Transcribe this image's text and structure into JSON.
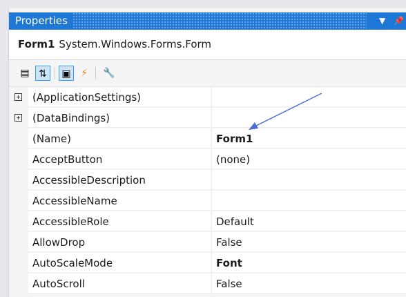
{
  "window": {
    "title": "Properties",
    "dropdown_glyph": "▼",
    "pin_glyph": "📌"
  },
  "object": {
    "name": "Form1",
    "type": "System.Windows.Forms.Form"
  },
  "colors": {
    "title_bar": "#1e78d7",
    "selection_border": "#3399ff",
    "events_bolt": "#e8821e",
    "annotation_arrow": "#4a6fd1"
  },
  "toolbar": {
    "buttons": [
      {
        "name": "categorized-button",
        "glyph": "▤",
        "active": false
      },
      {
        "name": "alphabetical-button",
        "glyph": "⇅",
        "active": true
      },
      {
        "name": "properties-view-button",
        "glyph": "▣",
        "active": true
      },
      {
        "name": "events-button",
        "glyph": "⚡",
        "active": false
      },
      {
        "name": "property-pages-button",
        "glyph": "🔧",
        "active": false
      }
    ]
  },
  "properties": [
    {
      "name": "(ApplicationSettings)",
      "value": "",
      "expandable": true,
      "bold": false
    },
    {
      "name": "(DataBindings)",
      "value": "",
      "expandable": true,
      "bold": false
    },
    {
      "name": "(Name)",
      "value": "Form1",
      "expandable": false,
      "bold": true
    },
    {
      "name": "AcceptButton",
      "value": "(none)",
      "expandable": false,
      "bold": false
    },
    {
      "name": "AccessibleDescription",
      "value": "",
      "expandable": false,
      "bold": false
    },
    {
      "name": "AccessibleName",
      "value": "",
      "expandable": false,
      "bold": false
    },
    {
      "name": "AccessibleRole",
      "value": "Default",
      "expandable": false,
      "bold": false
    },
    {
      "name": "AllowDrop",
      "value": "False",
      "expandable": false,
      "bold": false
    },
    {
      "name": "AutoScaleMode",
      "value": "Font",
      "expandable": false,
      "bold": true
    },
    {
      "name": "AutoScroll",
      "value": "False",
      "expandable": false,
      "bold": false
    }
  ]
}
